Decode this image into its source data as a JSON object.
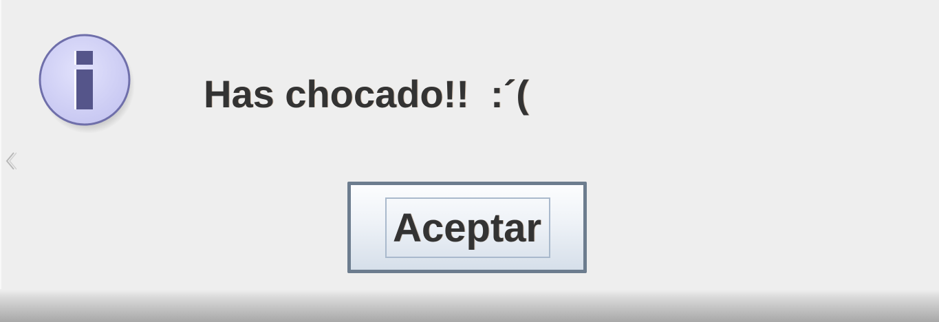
{
  "dialog": {
    "message": "Has chocado!!  :´(",
    "icon": "info-icon",
    "ok_button_label": "Aceptar"
  },
  "colors": {
    "background": "#eeeeee",
    "icon_fill": "#d4d4f8",
    "icon_border": "#6f6faa",
    "icon_glyph": "#55558a",
    "button_border": "#6c7c8e",
    "text": "#333333"
  }
}
